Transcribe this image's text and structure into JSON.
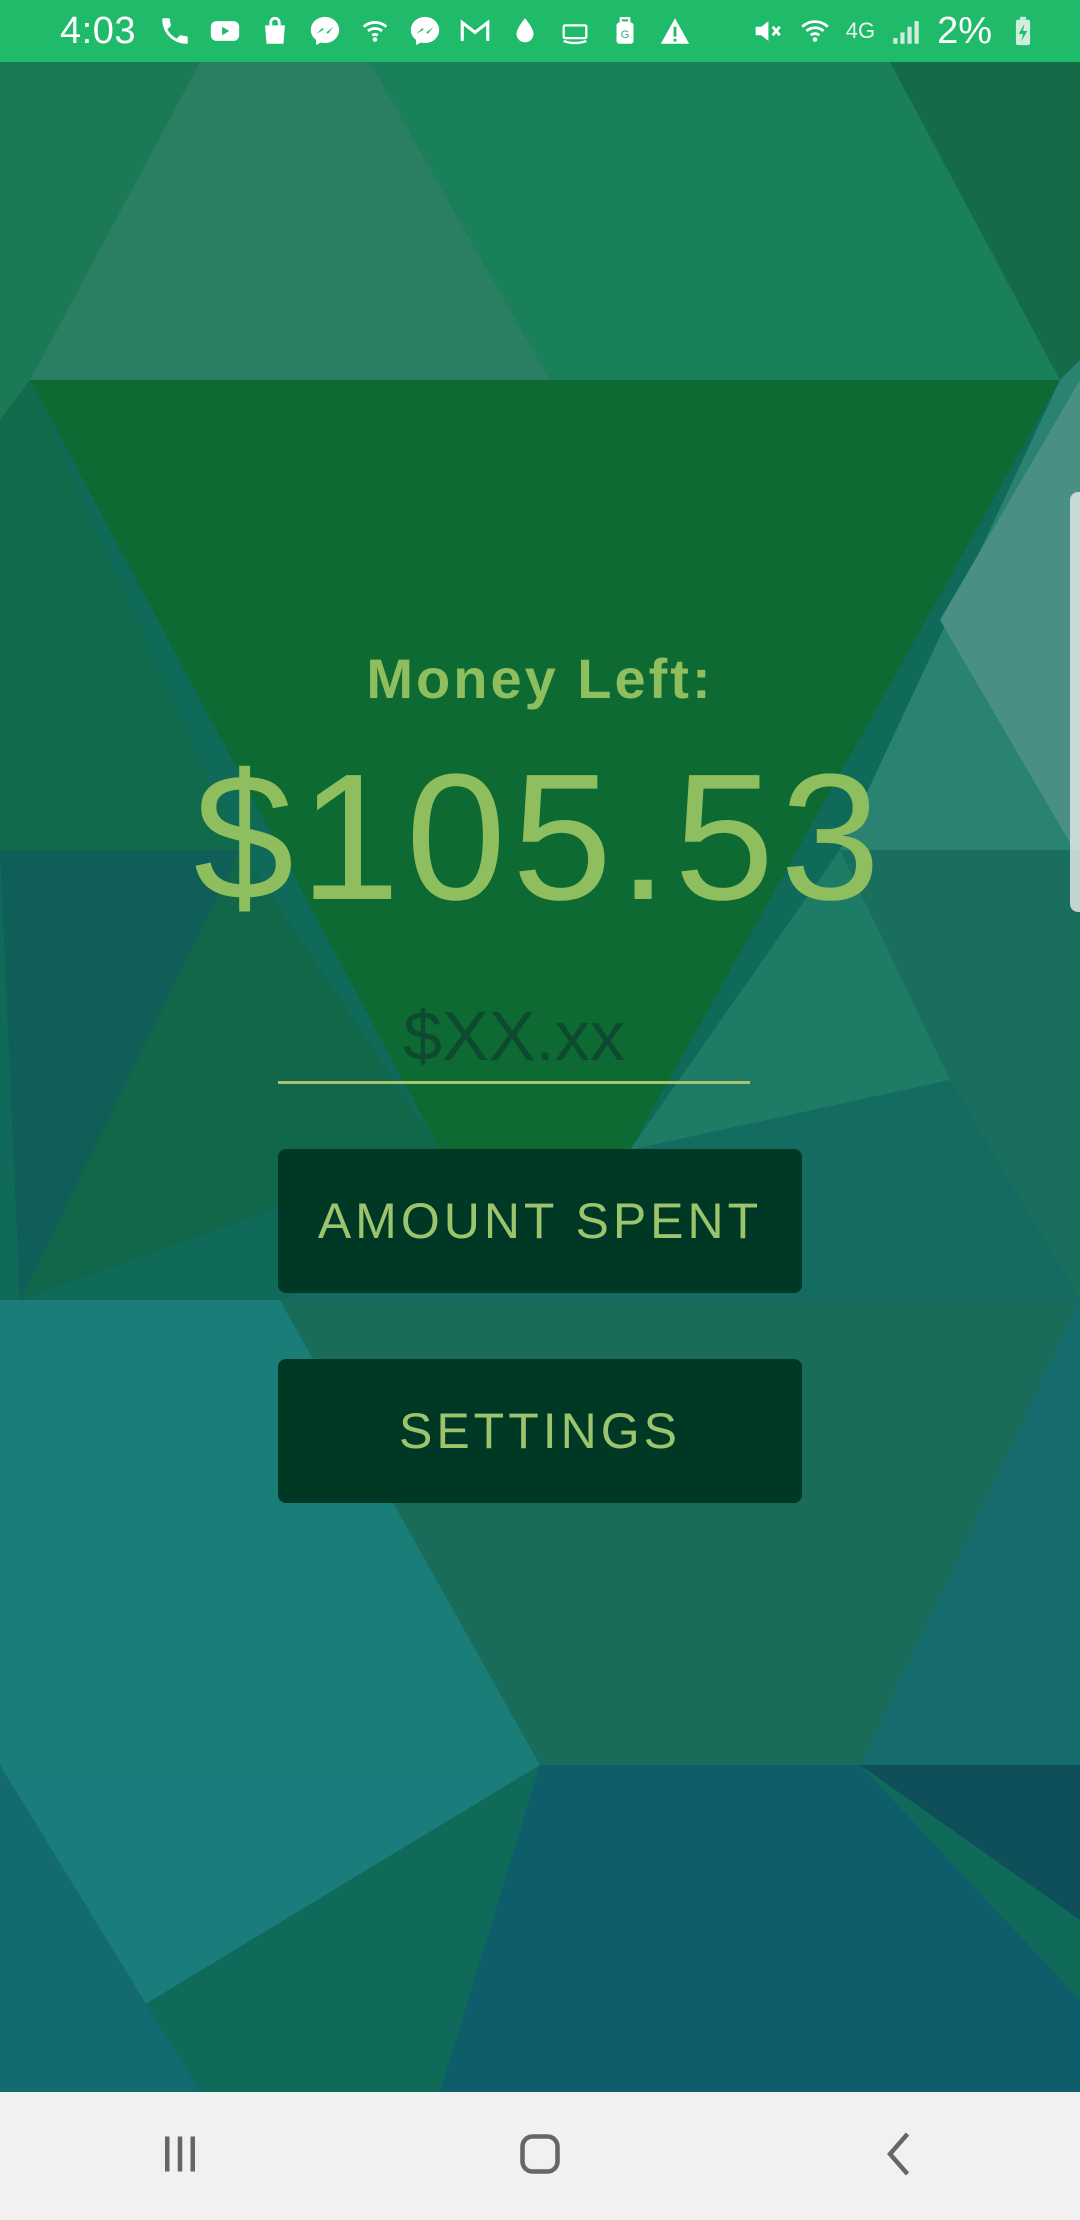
{
  "status_bar": {
    "time": "4:03",
    "battery_text": "2%",
    "network_type": "4G",
    "left_icons": [
      "phone-icon",
      "youtube-icon",
      "shopping-bag-icon",
      "messenger-icon",
      "wifi-call-icon",
      "messenger-icon",
      "gmail-icon",
      "drop-icon",
      "amazon-icon",
      "luggage-icon",
      "warning-icon"
    ],
    "right_icons": [
      "mute-icon",
      "wifi-icon",
      "signal-icon",
      "battery-icon"
    ],
    "background_color": "#1fba6a"
  },
  "main": {
    "money_label": "Money Left:",
    "money_value": "$105.53",
    "spent_input": {
      "value": "",
      "placeholder": "$XX.xx"
    },
    "amount_spent_button": "AMOUNT SPENT",
    "settings_button": "SETTINGS"
  },
  "colors": {
    "accent_text": "#8fbe5f",
    "button_bg": "#003826"
  },
  "nav_bar": {
    "buttons": [
      "recents-icon",
      "home-icon",
      "back-icon"
    ]
  }
}
